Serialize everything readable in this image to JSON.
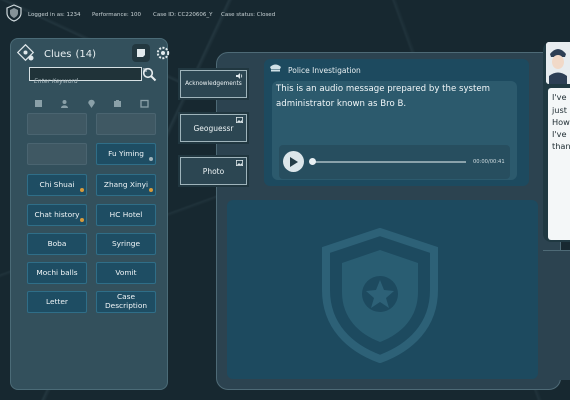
{
  "topbar": {
    "logged_in": "Logged in as: 1234",
    "performance": "Performance: 100",
    "case_id": "Case ID: CC220606_Y",
    "case_status": "Case status: Closed"
  },
  "clues": {
    "title": "Clues",
    "count": "(14)",
    "search_placeholder": "Enter Keyword",
    "items": [
      "Fu Yiming",
      "Chi Shuai",
      "Zhang Xinyi",
      "Chat history",
      "HC Hotel",
      "Boba",
      "Syringe",
      "Mochi balls",
      "Vomit",
      "Letter",
      "Case Description"
    ]
  },
  "tabs": {
    "acknowledgements": "Acknowledgements",
    "geoguessr": "Geoguessr",
    "photo": "Photo"
  },
  "audio": {
    "title": "Police Investigation",
    "message": "This is an audio message prepared by the system administrator known as Bro B.",
    "time": "00:00/00:41"
  },
  "chat": {
    "lines": [
      "I've",
      "just",
      "How",
      "I've",
      "than"
    ]
  },
  "colors": {
    "accent": "#1e4d63",
    "new_dot": "#d69a3b",
    "seen_dot": "#9fb2b9",
    "panel": "#33505c"
  }
}
